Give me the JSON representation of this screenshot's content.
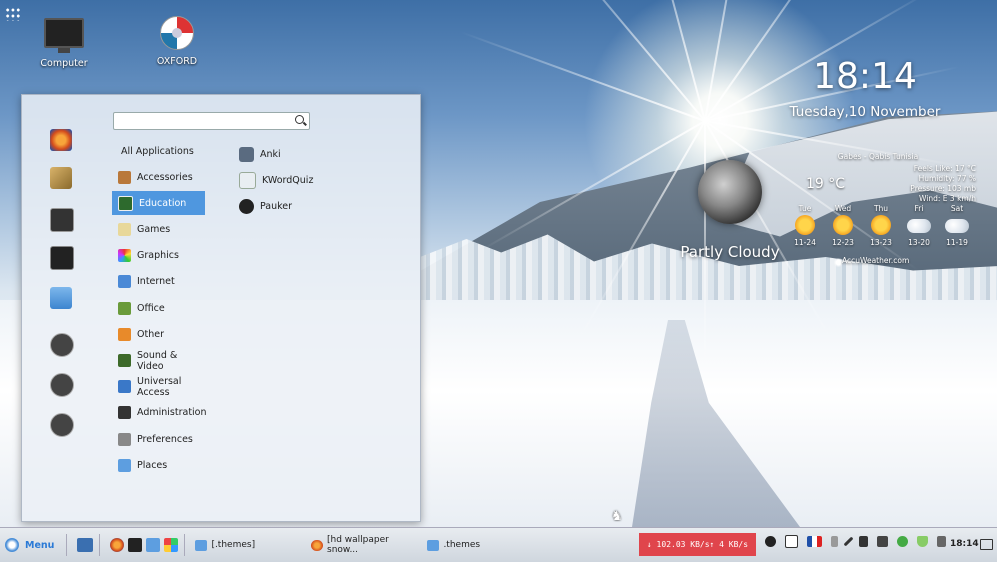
{
  "desktop": {
    "icons": [
      {
        "label": "Computer"
      },
      {
        "label": "OXFORD"
      }
    ]
  },
  "menu": {
    "search": {
      "value": "",
      "placeholder": ""
    },
    "categories": [
      {
        "label": "All Applications"
      },
      {
        "label": "Accessories"
      },
      {
        "label": "Education"
      },
      {
        "label": "Games"
      },
      {
        "label": "Graphics"
      },
      {
        "label": "Internet"
      },
      {
        "label": "Office"
      },
      {
        "label": "Other"
      },
      {
        "label": "Sound & Video"
      },
      {
        "label": "Universal Access"
      },
      {
        "label": "Administration"
      },
      {
        "label": "Preferences"
      },
      {
        "label": "Places"
      }
    ],
    "selected_category": "Education",
    "apps": [
      {
        "label": "Anki"
      },
      {
        "label": "KWordQuiz"
      },
      {
        "label": "Pauker"
      }
    ]
  },
  "widget": {
    "time": "18:14",
    "date": "Tuesday,10 November",
    "condition": "Partly Cloudy",
    "temperature": "19 °C",
    "location": "Gabes - Qabis Tunisia",
    "feels_like": "Feels Like: 17 °C",
    "humidity": "Humidity: 77 %",
    "pressure": "Pressure: 103 mb",
    "wind": "Wind: E 3 km/h",
    "forecast": [
      {
        "day": "Tue",
        "range": "11-24",
        "icon": "sun"
      },
      {
        "day": "Wed",
        "range": "12-23",
        "icon": "sun"
      },
      {
        "day": "Thu",
        "range": "13-23",
        "icon": "sun"
      },
      {
        "day": "Fri",
        "range": "13-20",
        "icon": "cloud"
      },
      {
        "day": "Sat",
        "range": "11-19",
        "icon": "cloud"
      }
    ],
    "provider": "AccuWeather.com"
  },
  "taskbar": {
    "menu_label": "Menu",
    "tasks": [
      {
        "label": "[.themes]"
      },
      {
        "label": "[hd wallpaper snow..."
      },
      {
        "label": ".themes"
      }
    ],
    "netspeed": "↓ 102.03 KB/s↑ 4 KB/s",
    "clock": "18:14"
  },
  "colors": {
    "accent": "#4f97df",
    "netmon": "#e0454c"
  }
}
